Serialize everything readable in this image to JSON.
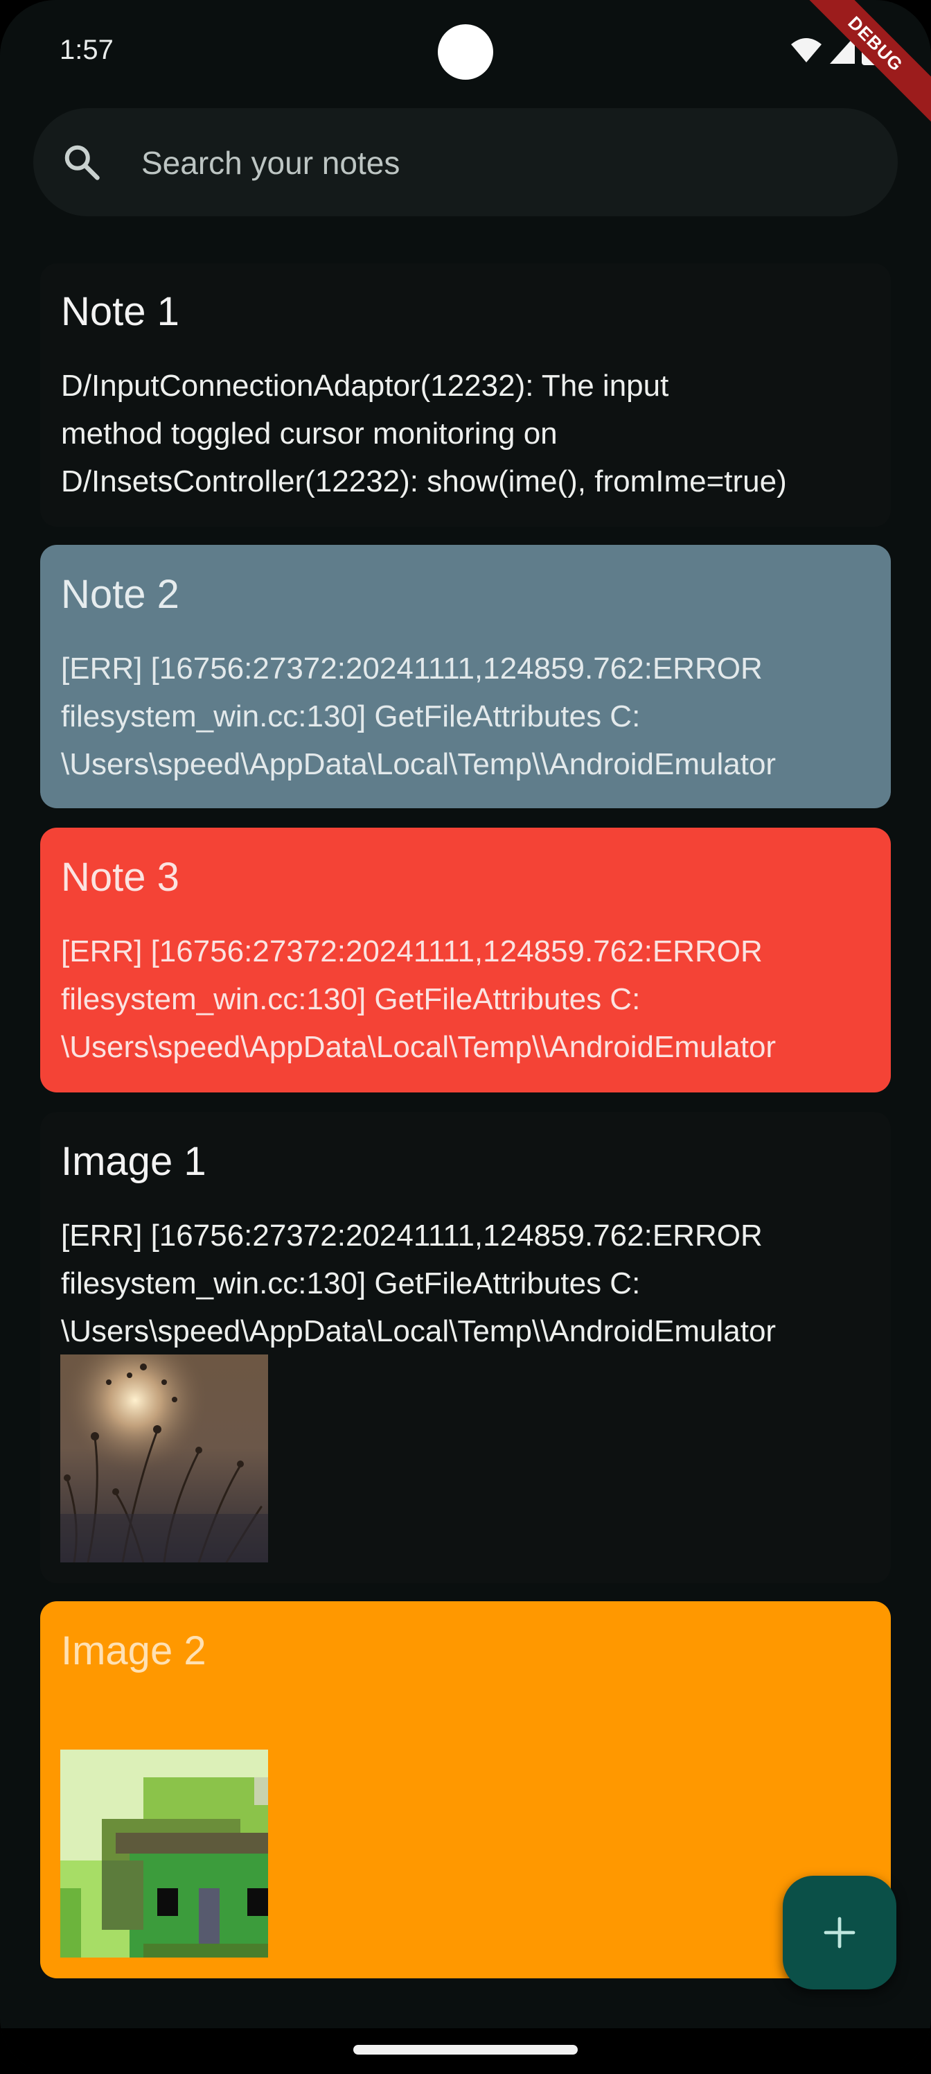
{
  "status_bar": {
    "time": "1:57",
    "debug_label": "DEBUG"
  },
  "search": {
    "placeholder": "Search your notes"
  },
  "notes": [
    {
      "title": "Note 1",
      "lines": [
        "D/InputConnectionAdaptor(12232): The input",
        "method toggled cursor monitoring on",
        "D/InsetsController(12232): show(ime(), fromIme=true)"
      ],
      "color": "#0d1111"
    },
    {
      "title": "Note 2",
      "lines": [
        "[ERR] [16756:27372:20241111,124859.762:ERROR",
        "filesystem_win.cc:130] GetFileAttributes C:",
        "\\Users\\speed\\AppData\\Local\\Temp\\\\AndroidEmulator"
      ],
      "color": "#607d8b"
    },
    {
      "title": "Note 3",
      "lines": [
        "[ERR] [16756:27372:20241111,124859.762:ERROR",
        "filesystem_win.cc:130] GetFileAttributes C:",
        "\\Users\\speed\\AppData\\Local\\Temp\\\\AndroidEmulator"
      ],
      "color": "#f44336"
    },
    {
      "title": "Image 1",
      "lines": [
        "[ERR] [16756:27372:20241111,124859.762:ERROR",
        "filesystem_win.cc:130] GetFileAttributes C:",
        "\\Users\\speed\\AppData\\Local\\Temp\\\\AndroidEmulator"
      ],
      "color": "#0d1111"
    },
    {
      "title": "Image 2",
      "lines": [],
      "color": "#ff9800"
    }
  ],
  "fab": {
    "icon": "plus-icon"
  }
}
